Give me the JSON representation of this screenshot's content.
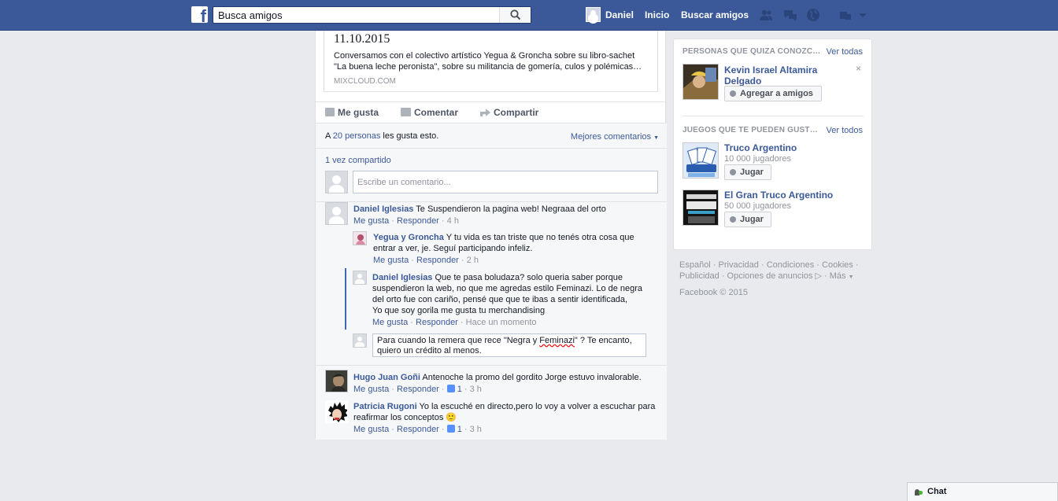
{
  "topbar": {
    "search_placeholder": "Busca amigos",
    "user_name": "Daniel",
    "home_label": "Inicio",
    "find_friends_label": "Buscar amigos"
  },
  "share": {
    "title": "11.10.2015",
    "description": "Conversamos con el colectivo artístico Yegua & Groncha sobre su libro-sachet \"La buena leche peronista\", sobre su militancia de gomería, culos y polémicas…",
    "source": "MIXCLOUD.COM"
  },
  "actions": {
    "like": "Me gusta",
    "comment": "Comentar",
    "share": "Compartir"
  },
  "ufi": {
    "likes_prefix": "A ",
    "likes_link": "20 personas",
    "likes_suffix": " les gusta esto.",
    "best_comments": "Mejores comentarios",
    "shared": "1 vez compartido",
    "comment_placeholder": "Escribe un comentario..."
  },
  "comments": [
    {
      "author": "Daniel Iglesias",
      "text": "Te Suspendieron la pagina web! Negraaa del orto",
      "like": "Me gusta",
      "reply": "Responder",
      "time": "4 h",
      "replies": [
        {
          "author": "Yegua y Groncha",
          "text": "Y tu vida es tan triste que no tenés otra cosa que entrar a ver, je. Seguí participando infeliz.",
          "like": "Me gusta",
          "reply": "Responder",
          "time": "2 h"
        },
        {
          "author": "Daniel Iglesias",
          "text": "Que te pasa boludaza? solo queria saber porque suspendieron la web, no que me agredas estilo Feminazi. Lo de negra del orto fue con cariño, pensé que que te ibas a sentir identificada,",
          "text2": "Yo que soy gorila me gusta tu merchandising",
          "like": "Me gusta",
          "reply": "Responder",
          "time": "Hace un momento"
        }
      ],
      "draft_reply_before": "Para cuando la remera que rece \"Negra y ",
      "draft_reply_misspelled": "Feminazi",
      "draft_reply_after": "\" ? Te encanto, quiero un crédito al menos."
    },
    {
      "author": "Hugo Juan Goñi",
      "text": "Antenoche la promo del gordito Jorge estuvo invalorable.",
      "like": "Me gusta",
      "reply": "Responder",
      "likes": "1",
      "time": "3 h"
    },
    {
      "author": "Patricia Rugoni",
      "text": "Yo la escuché en directo,pero lo voy a volver a escuchar para reafirmar los conceptos",
      "emoji": "🙂",
      "like": "Me gusta",
      "reply": "Responder",
      "likes": "1",
      "time": "3 h"
    }
  ],
  "sidebar": {
    "people_heading": "PERSONAS QUE QUIZA CONOZC…",
    "people_see_all": "Ver todas",
    "person_name": "Kevin Israel Altamira Delgado",
    "add_friend": "Agregar a amigos",
    "close": "×",
    "games_heading": "JUEGOS QUE TE PUEDEN GUST…",
    "games_see_all": "Ver todos",
    "games": [
      {
        "name": "Truco Argentino",
        "players": "10 000 jugadores",
        "play": "Jugar"
      },
      {
        "name": "El Gran Truco Argentino",
        "players": "50 000 jugadores",
        "play": "Jugar"
      }
    ]
  },
  "footer": {
    "links": [
      "Español",
      "Privacidad",
      "Condiciones",
      "Cookies",
      "Publicidad",
      "Opciones de anuncios",
      "Más"
    ],
    "copyright": "Facebook © 2015"
  },
  "chat": {
    "label": "Chat"
  },
  "colors": {
    "brand": "#3b5998",
    "link": "#3b5998",
    "background": "#e9eaed",
    "reply_indicator": "#4267b2",
    "online": "#42b72a"
  }
}
